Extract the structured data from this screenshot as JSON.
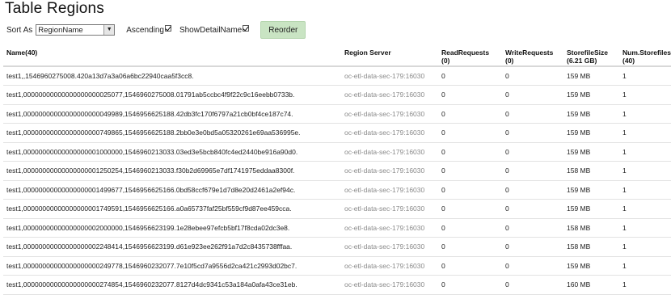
{
  "page": {
    "title": "Table Regions"
  },
  "controls": {
    "sort_label": "Sort As",
    "sort_value": "RegionName",
    "ascending_label": "Ascending",
    "show_detail_label": "ShowDetailName",
    "reorder_label": "Reorder",
    "ascending_checked": true,
    "show_detail_checked": true
  },
  "table": {
    "headers": [
      "Name(40)",
      "Region Server",
      "ReadRequests (0)",
      "WriteRequests (0)",
      "StorefileSize (6.21 GB)",
      "Num.Storefiles (40)"
    ],
    "rows": [
      [
        "test1,,1546960275008.420a13d7a3a06a6bc22940caa5f3cc8.",
        "oc-etl-data-sec-179:16030",
        "0",
        "0",
        "159 MB",
        "1"
      ],
      [
        "test1,00000000000000000000025077,1546960275008.01791ab5ccbc4f9f22c9c16eebb0733b.",
        "oc-etl-data-sec-179:16030",
        "0",
        "0",
        "159 MB",
        "1"
      ],
      [
        "test1,00000000000000000000049989,1546956625188.42db3fc170f6797a21cb0bf4ce187c74.",
        "oc-etl-data-sec-179:16030",
        "0",
        "0",
        "159 MB",
        "1"
      ],
      [
        "test1,00000000000000000000749865,1546956625188.2bb0e3e0bd5a05320261e69aa536995e.",
        "oc-etl-data-sec-179:16030",
        "0",
        "0",
        "159 MB",
        "1"
      ],
      [
        "test1,00000000000000000001000000,1546960213033.03ed3e5bcb840fc4ed2440be916a90d0.",
        "oc-etl-data-sec-179:16030",
        "0",
        "0",
        "159 MB",
        "1"
      ],
      [
        "test1,00000000000000000001250254,1546960213033.f30b2d69965e7df1741975eddaa8300f.",
        "oc-etl-data-sec-179:16030",
        "0",
        "0",
        "158 MB",
        "1"
      ],
      [
        "test1,00000000000000000001499677,1546956625166.0bd58ccf679e1d7d8e20d2461a2ef94c.",
        "oc-etl-data-sec-179:16030",
        "0",
        "0",
        "159 MB",
        "1"
      ],
      [
        "test1,00000000000000000001749591,1546956625166.a0a65737faf25bf559cf9d87ee459cca.",
        "oc-etl-data-sec-179:16030",
        "0",
        "0",
        "159 MB",
        "1"
      ],
      [
        "test1,00000000000000000002000000,1546956623199.1e28ebee97efcb5bf17f8cda02dc3e8.",
        "oc-etl-data-sec-179:16030",
        "0",
        "0",
        "158 MB",
        "1"
      ],
      [
        "test1,00000000000000000002248414,1546956623199.d61e923ee262f91a7d2c8435738fffaa.",
        "oc-etl-data-sec-179:16030",
        "0",
        "0",
        "158 MB",
        "1"
      ],
      [
        "test1,00000000000000000000249778,1546960232077.7e10f5cd7a9556d2ca421c2993d02bc7.",
        "oc-etl-data-sec-179:16030",
        "0",
        "0",
        "159 MB",
        "1"
      ],
      [
        "test1,00000000000000000000274854,1546960232077.8127d4dc9341c53a184a0afa43ce31eb.",
        "oc-etl-data-sec-179:16030",
        "0",
        "0",
        "160 MB",
        "1"
      ]
    ]
  }
}
